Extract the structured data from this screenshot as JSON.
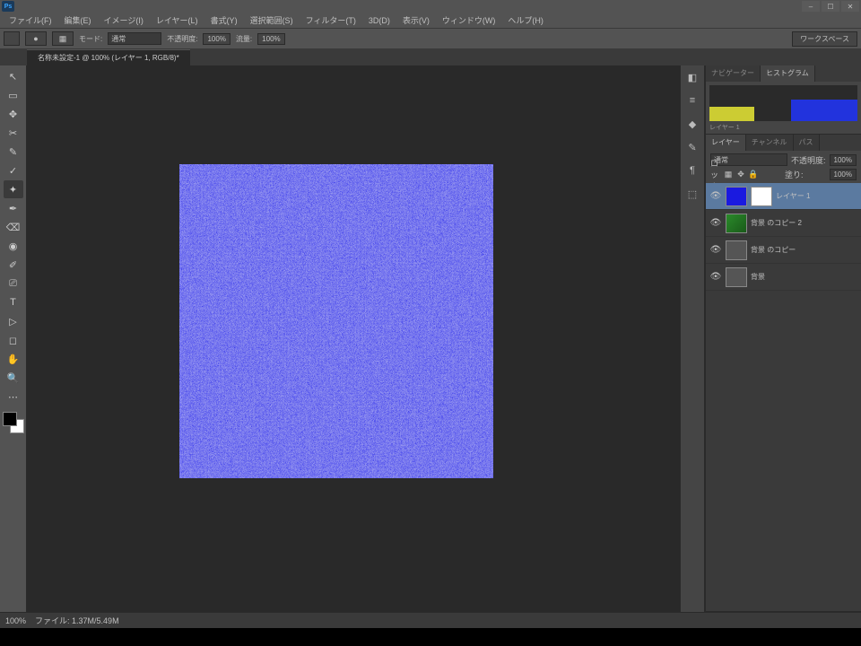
{
  "app": {
    "logo": "Ps"
  },
  "menubar": [
    "ファイル(F)",
    "編集(E)",
    "イメージ(I)",
    "レイヤー(L)",
    "書式(Y)",
    "選択範囲(S)",
    "フィルター(T)",
    "3D(D)",
    "表示(V)",
    "ウィンドウ(W)",
    "ヘルプ(H)"
  ],
  "options": {
    "mode_label": "モード:",
    "mode_value": "通常",
    "opacity_label": "不透明度:",
    "opacity_value": "100%",
    "flow_label": "流量:",
    "flow_value": "100%",
    "right_button": "ワークスペース"
  },
  "document": {
    "tab": "名称未設定-1 @ 100% (レイヤー 1, RGB/8)*"
  },
  "panels": {
    "nav_tabs": [
      "ナビゲーター",
      "ヒストグラム"
    ],
    "histogram_label": "レイヤー 1"
  },
  "layers_panel": {
    "tabs": [
      "レイヤー",
      "チャンネル",
      "パス"
    ],
    "blend_label": "通常",
    "opacity_label": "不透明度:",
    "opacity_value": "100%",
    "lock_label": "ロック:",
    "fill_label": "塗り:",
    "fill_value": "100%",
    "layers": [
      {
        "name": "レイヤー 1",
        "thumbs": [
          "blue",
          "mask"
        ],
        "selected": true,
        "visible": true
      },
      {
        "name": "背景 のコピー 2",
        "thumbs": [
          "green"
        ],
        "selected": false,
        "visible": true
      },
      {
        "name": "背景 のコピー",
        "thumbs": [
          "gray"
        ],
        "selected": false,
        "visible": true
      },
      {
        "name": "背景",
        "thumbs": [
          "gray"
        ],
        "selected": false,
        "visible": true
      }
    ]
  },
  "statusbar": {
    "zoom": "100%",
    "info": "ファイル: 1.37M/5.49M"
  },
  "tool_icons": [
    "↖",
    "▭",
    "✥",
    "✂",
    "✎",
    "✓",
    "✦",
    "✒",
    "⌫",
    "◉",
    "✐",
    "⎚",
    "T",
    "▷",
    "◻",
    "✋",
    "🔍",
    "⋯"
  ],
  "dock_icons": [
    "◧",
    "≡",
    "◆",
    "✎",
    "¶",
    "⬚"
  ]
}
